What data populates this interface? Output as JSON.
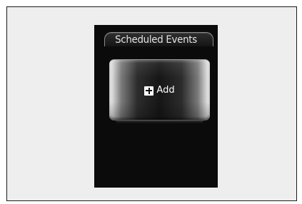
{
  "screen": {
    "title": "Scheduled Events",
    "add_button": {
      "label": "Add",
      "icon": "plus-icon"
    }
  },
  "colors": {
    "screen_background": "#0b0b0b",
    "frame_background": "#edeeed",
    "text": "#ffffff"
  }
}
